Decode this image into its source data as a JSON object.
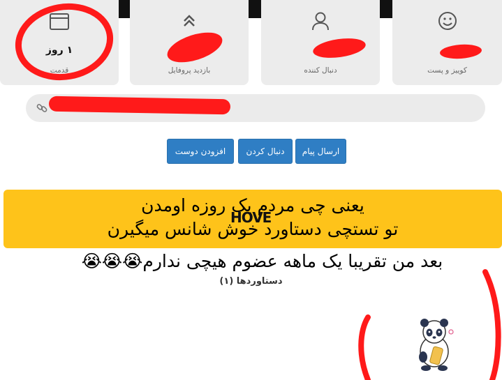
{
  "stats": [
    {
      "label": "قدمت",
      "value": "۱ روز",
      "icon": "calendar-icon"
    },
    {
      "label": "بازدید پروفایل",
      "value": "",
      "icon": "double-chevron-up-icon"
    },
    {
      "label": "دنبال کننده",
      "value": "",
      "icon": "user-icon"
    },
    {
      "label": "کوییز و پست",
      "value": "",
      "icon": "smiley-icon"
    }
  ],
  "link": {
    "icon": "link-icon",
    "value": ""
  },
  "buttons": {
    "send_message": "ارسال پیام",
    "follow": "دنبال کردن",
    "add_friend": "افزودن دوست"
  },
  "caption": {
    "line1": "یعنی چی مردم یک روزه اومدن",
    "line2": "تو تستچی دستاورد خوش شانس میگیرن",
    "line3": "بعد من تقریبا یک ماهه عضوم هیچی ندارم😭😭😭"
  },
  "watermark": "HOVE",
  "achievements": {
    "title": "دستاوردها (۱)",
    "badge_icon": "panda-badge-icon"
  },
  "colors": {
    "button_blue": "#2f7ec4",
    "caption_yellow": "#fec31a",
    "scribble_red": "#ff1a1a",
    "card_gray": "#ececec"
  }
}
